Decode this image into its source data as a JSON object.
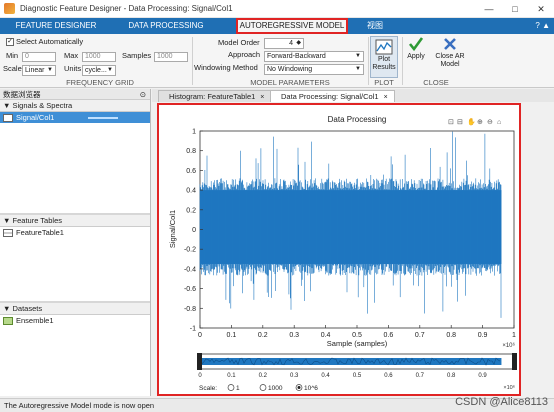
{
  "window": {
    "title": "Diagnostic Feature Designer - Data Processing: Signal/Col1",
    "controls": [
      "—",
      "□",
      "✕"
    ]
  },
  "tabs": [
    "FEATURE DESIGNER",
    "DATA PROCESSING",
    "AUTOREGRESSIVE MODEL",
    "视图"
  ],
  "tab_mini": "? ▲",
  "ribbon": {
    "frequency_grid": {
      "select_auto": "Select Automatically",
      "min_label": "Min",
      "min_placeholder": "0",
      "max_label": "Max",
      "max_placeholder": "1000",
      "samples_label": "Samples",
      "samples_placeholder": "1000",
      "scale_label": "Scale",
      "scale_value": "Linear",
      "units_label": "Units",
      "units_value": "cycle...",
      "group_label": "FREQUENCY GRID"
    },
    "model": {
      "order_label": "Model Order",
      "order_value": "4",
      "approach_label": "Approach",
      "approach_value": "Forward-Backward",
      "windowing_label": "Windowing Method",
      "windowing_value": "No Windowing",
      "group_label": "MODEL PARAMETERS"
    },
    "plot": {
      "plot_results": "Plot Results",
      "group_label": "PLOT"
    },
    "close": {
      "apply": "Apply",
      "close_ar": "Close AR Model",
      "group_label": "CLOSE"
    }
  },
  "browser": {
    "header": "数据浏览器",
    "signals_title": "Signals & Spectra",
    "signal_item": "Signal/Col1",
    "feature_tables_title": "Feature Tables",
    "feature_item": "FeatureTable1",
    "datasets_title": "Datasets",
    "dataset_item": "Ensemble1"
  },
  "doc_tabs": [
    "Histogram: FeatureTable1",
    "Data Processing: Signal/Col1"
  ],
  "status_text": "The Autoregressive Model mode is now open",
  "watermark": "CSDN @Alice8113",
  "colors": {
    "signal": "#1f77c0",
    "tab_bar": "#1f6fb4",
    "highlight": "#e02424"
  },
  "chart_data": {
    "type": "line",
    "title": "Data Processing",
    "xlabel": "Sample (samples)",
    "ylabel": "Signal/Col1",
    "x_exponent_label": "×10⁶",
    "xlim": [
      0,
      1000000
    ],
    "ylim": [
      -1,
      1
    ],
    "x_ticks": [
      "0",
      "0.1",
      "0.2",
      "0.3",
      "0.4",
      "0.5",
      "0.6",
      "0.7",
      "0.8",
      "0.9",
      "1"
    ],
    "y_ticks": [
      "1",
      "0.8",
      "0.6",
      "0.4",
      "0.2",
      "0",
      "-0.2",
      "-0.4",
      "-0.6",
      "-0.8",
      "-1"
    ],
    "signal_end": 960000,
    "band": {
      "typical_low": -0.35,
      "typical_high": 0.4,
      "peak_low": -0.9,
      "peak_high": 1.0
    },
    "panner": {
      "x_ticks": [
        "0",
        "0.1",
        "0.2",
        "0.3",
        "0.4",
        "0.5",
        "0.6",
        "0.7",
        "0.8",
        "0.9"
      ],
      "scale_label": "Scale:",
      "scale_options": [
        "1",
        "1000",
        "10^6"
      ],
      "scale_selected": 2
    }
  }
}
